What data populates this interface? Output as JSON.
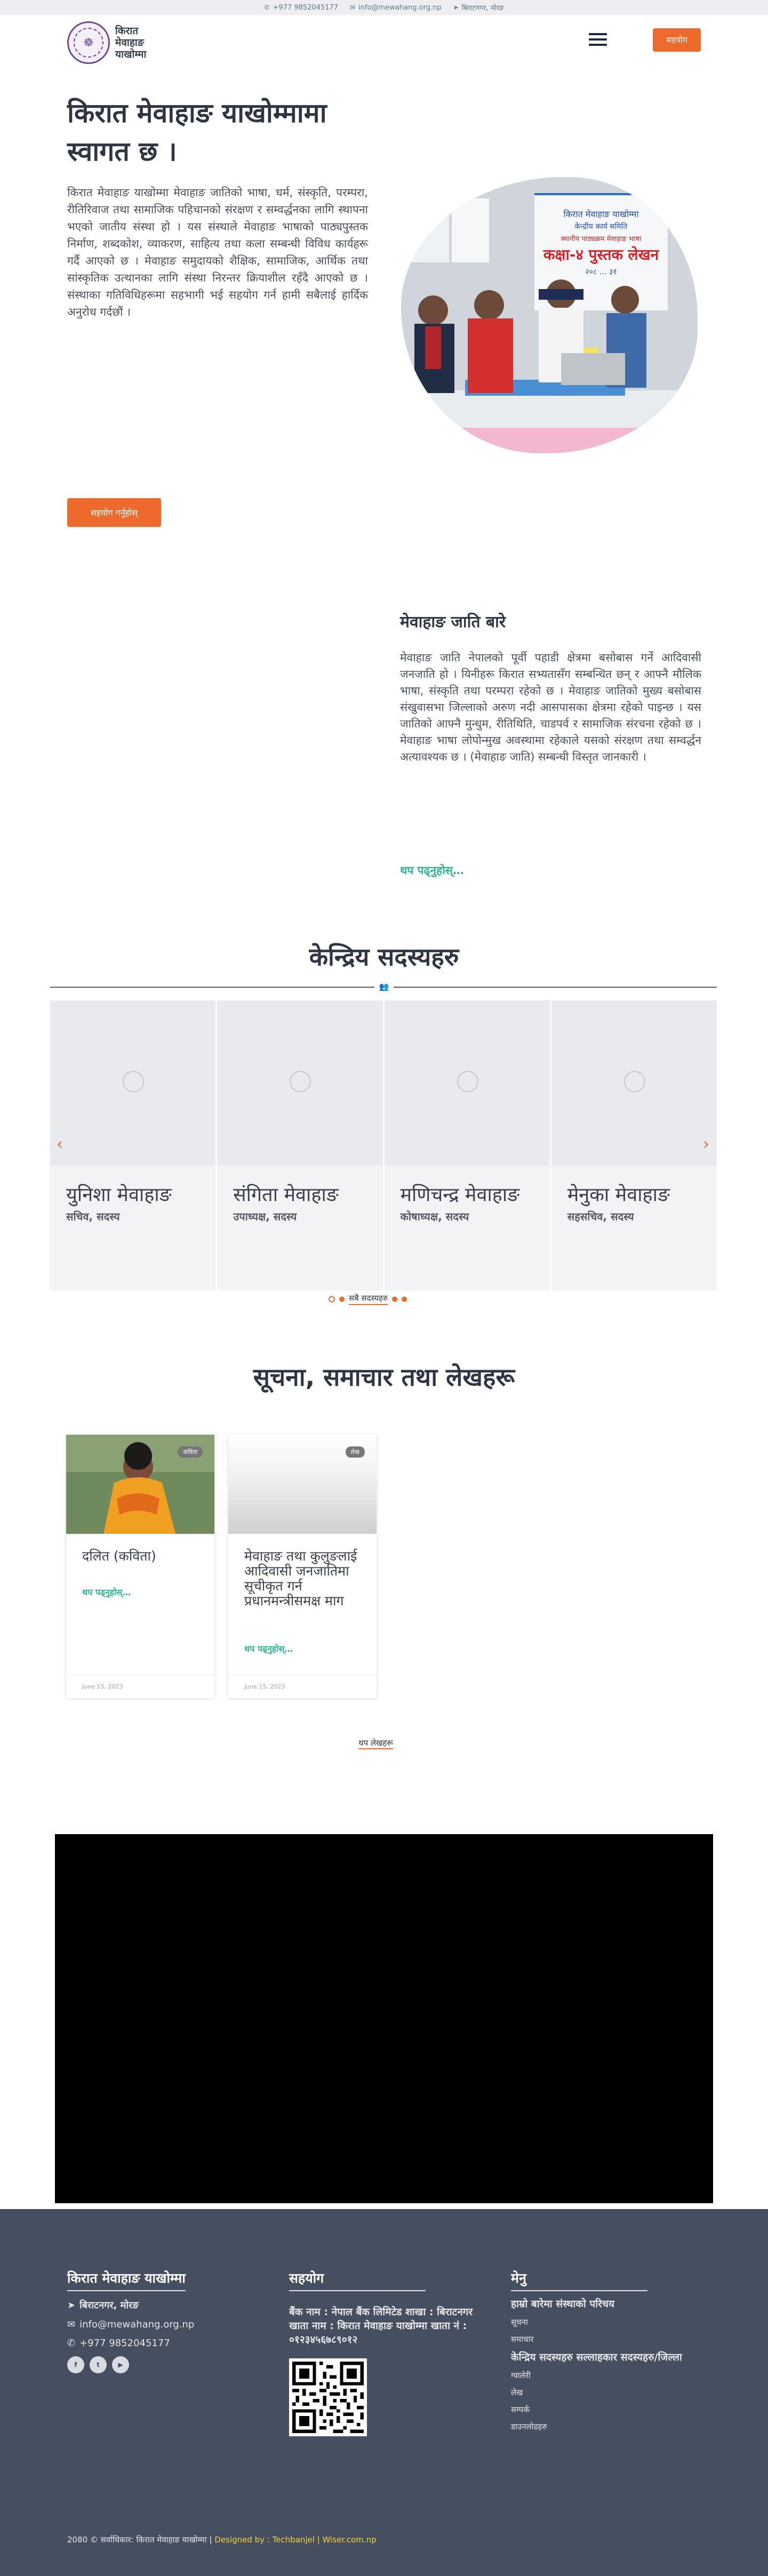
{
  "topbar": {
    "phone": "+977 9852045177",
    "email": "info@mewahang.org.np",
    "location": "बिराटनगर, मोरङ"
  },
  "header": {
    "logo_text": "किरात मेवाहाङ याखोम्मा",
    "donate_label": "सहयोग"
  },
  "hero": {
    "title": "किरात मेवाहाङ याखोम्मामा स्वागत छ ।",
    "body": "किरात मेवाहाङ याखोम्मा मेवाहाङ जातिको भाषा, धर्म, संस्कृति, परम्परा, रीतिरिवाज तथा सामाजिक पहिचानको संरक्षण र सम्वर्द्धनका लागि स्थापना भएको जातीय संस्था हो । यस संस्थाले मेवाहाङ भाषाको पाठ्यपुस्तक निर्माण, शब्दकोश, व्याकरण, साहित्य तथा कला सम्बन्धी विविध कार्यहरू गर्दै आएको छ । मेवाहाङ समुदायको शैक्षिक, सामाजिक, आर्थिक तथा सांस्कृतिक उत्थानका लागि संस्था निरन्तर क्रियाशील रहँदै आएको छ । संस्थाका गतिविधिहरूमा सहभागी भई सहयोग गर्न हामी सबैलाई हार्दिक अनुरोध गर्दछौं ।",
    "cta_label": "सहयोग गर्नुहोस्",
    "image_banner_line1": "किरात मेवाहाङ याखोम्मा",
    "image_banner_line2": "केन्द्रीय कार्य समिति",
    "image_banner_line3": "स्थानीय पाठ्यक्रम मेवाहाङ भाषा",
    "image_banner_main": "कक्षा-४ पुस्तक लेखन",
    "image_banner_year": "२०८ … ३१"
  },
  "about": {
    "title": "मेवाहाङ जाति बारे",
    "body": "मेवाहाङ जाति नेपालको पूर्वी पहाडी क्षेत्रमा बसोबास गर्ने आदिवासी जनजाति हो । यिनीहरू किरात सभ्यतासँग सम्बन्धित छन् र आफ्नै मौलिक भाषा, संस्कृति तथा परम्परा रहेको छ । मेवाहाङ जातिको मुख्य बसोबास संखुवासभा जिल्लाको अरुण नदी आसपासका क्षेत्रमा रहेको पाइन्छ । यस जातिको आफ्नै मुन्धुम, रीतिथिति, चाडपर्व र सामाजिक संरचना रहेको छ । मेवाहाङ भाषा लोपोन्मुख अवस्थामा रहेकाले यसको संरक्षण तथा सम्वर्द्धन अत्यावश्यक छ । (मेवाहाङ जाति) सम्बन्धी विस्तृत जानकारी ।",
    "read_more": "थप पढ्नुहोस्…"
  },
  "members": {
    "title": "केन्द्रिय सदस्यहरु",
    "items": [
      {
        "name": "युनिशा मेवाहाङ",
        "role": "सचिव, सदस्य"
      },
      {
        "name": "संगिता मेवाहाङ",
        "role": "उपाध्यक्ष, सदस्य"
      },
      {
        "name": "मणिचन्द्र मेवाहाङ",
        "role": "कोषाध्यक्ष, सदस्य"
      },
      {
        "name": "मेनुका मेवाहाङ",
        "role": "सहसचिव, सदस्य"
      }
    ],
    "all_link": "सबै सदस्यहरु"
  },
  "news": {
    "title": "सूचना, समाचार तथा लेखहरू",
    "items": [
      {
        "badge": "कविता",
        "title": "दलित (कविता)",
        "more": "थप पढ्नुहोस्…",
        "date": "June 15, 2023"
      },
      {
        "badge": "लेख",
        "title": "मेवाहाङ तथा कुलुङलाई आदिवासी जनजातिमा सूचीकृत गर्न प्रधानमन्त्रीसमक्ष माग",
        "more": "थप पढ्नुहोस्…",
        "date": "June 15, 2023"
      }
    ],
    "more_link": "थप लेखहरू"
  },
  "footer": {
    "org_title": "किरात मेवाहाङ याखोम्मा",
    "location": "बिराटनगर, मोरङ",
    "email": "info@mewahang.org.np",
    "phone": "+977 9852045177",
    "support_title": "सहयोग",
    "support_text": "बैंक नाम : नेपाल बैंक लिमिटेड शाखा : बिराटनगर खाता नाम : किरात मेवाहाङ याखोम्मा खाता नं : ०१२३४५६७८९०१२",
    "menu_title": "मेनु",
    "menu_items": [
      {
        "label": "हाम्रो बारेमा संस्थाको परिचय",
        "big": true
      },
      {
        "label": "सूचना",
        "big": false
      },
      {
        "label": "समाचार",
        "big": false
      },
      {
        "label": "केन्द्रिय सदस्यहरु सल्लाहकार सदस्यहरु/जिल्ला",
        "big": true
      },
      {
        "label": "ग्यालेरी",
        "big": false
      },
      {
        "label": "लेख",
        "big": false
      },
      {
        "label": "सम्पर्क",
        "big": false
      },
      {
        "label": "डाउनलोडहरु",
        "big": false
      }
    ],
    "copyright": "2080 © सर्वाधिकार: किरात मेवाहाङ याखोम्मा |",
    "designed_by": "Designed by : Techbanjel | Wiser.com.np"
  },
  "colors": {
    "accent": "#ee6a2c",
    "link_green": "#2fb58f",
    "footer_bg": "#464f5f",
    "heading": "#2f3542"
  }
}
